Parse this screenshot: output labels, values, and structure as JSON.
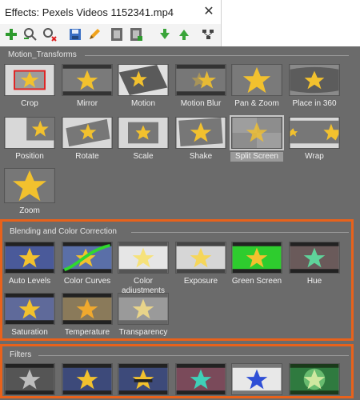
{
  "window": {
    "title": "Effects: Pexels Videos 1152341.mp4",
    "close_glyph": "✕"
  },
  "toolbar": {
    "buttons": [
      {
        "name": "add-effect-icon"
      },
      {
        "name": "add-effect-magnify-icon"
      },
      {
        "name": "remove-effect-icon"
      },
      {
        "name": "save-icon"
      },
      {
        "name": "edit-pencil-icon"
      },
      {
        "name": "film-frame-icon"
      },
      {
        "name": "film-frame-add-icon"
      },
      {
        "name": "move-down-icon"
      },
      {
        "name": "move-up-icon"
      },
      {
        "name": "settings-tree-icon"
      }
    ]
  },
  "sections": {
    "motion": {
      "title": "Motion_Transforms",
      "items": [
        {
          "label": "Crop"
        },
        {
          "label": "Mirror"
        },
        {
          "label": "Motion"
        },
        {
          "label": "Motion Blur"
        },
        {
          "label": "Pan & Zoom"
        },
        {
          "label": "Place in 360"
        },
        {
          "label": "Position"
        },
        {
          "label": "Rotate"
        },
        {
          "label": "Scale"
        },
        {
          "label": "Shake"
        },
        {
          "label": "Split Screen"
        },
        {
          "label": "Wrap"
        },
        {
          "label": "Zoom"
        }
      ]
    },
    "blending": {
      "title": "Blending and Color Correction",
      "items": [
        {
          "label": "Auto Levels"
        },
        {
          "label": "Color Curves"
        },
        {
          "label": "Color adjustments"
        },
        {
          "label": "Exposure"
        },
        {
          "label": "Green Screen"
        },
        {
          "label": "Hue"
        },
        {
          "label": "Saturation"
        },
        {
          "label": "Temperature"
        },
        {
          "label": "Transparency"
        }
      ]
    },
    "filters": {
      "title": "Filters"
    }
  },
  "colors": {
    "highlight": "#e8621b",
    "panel": "#6b6b6b",
    "star": "#f2c12e"
  }
}
